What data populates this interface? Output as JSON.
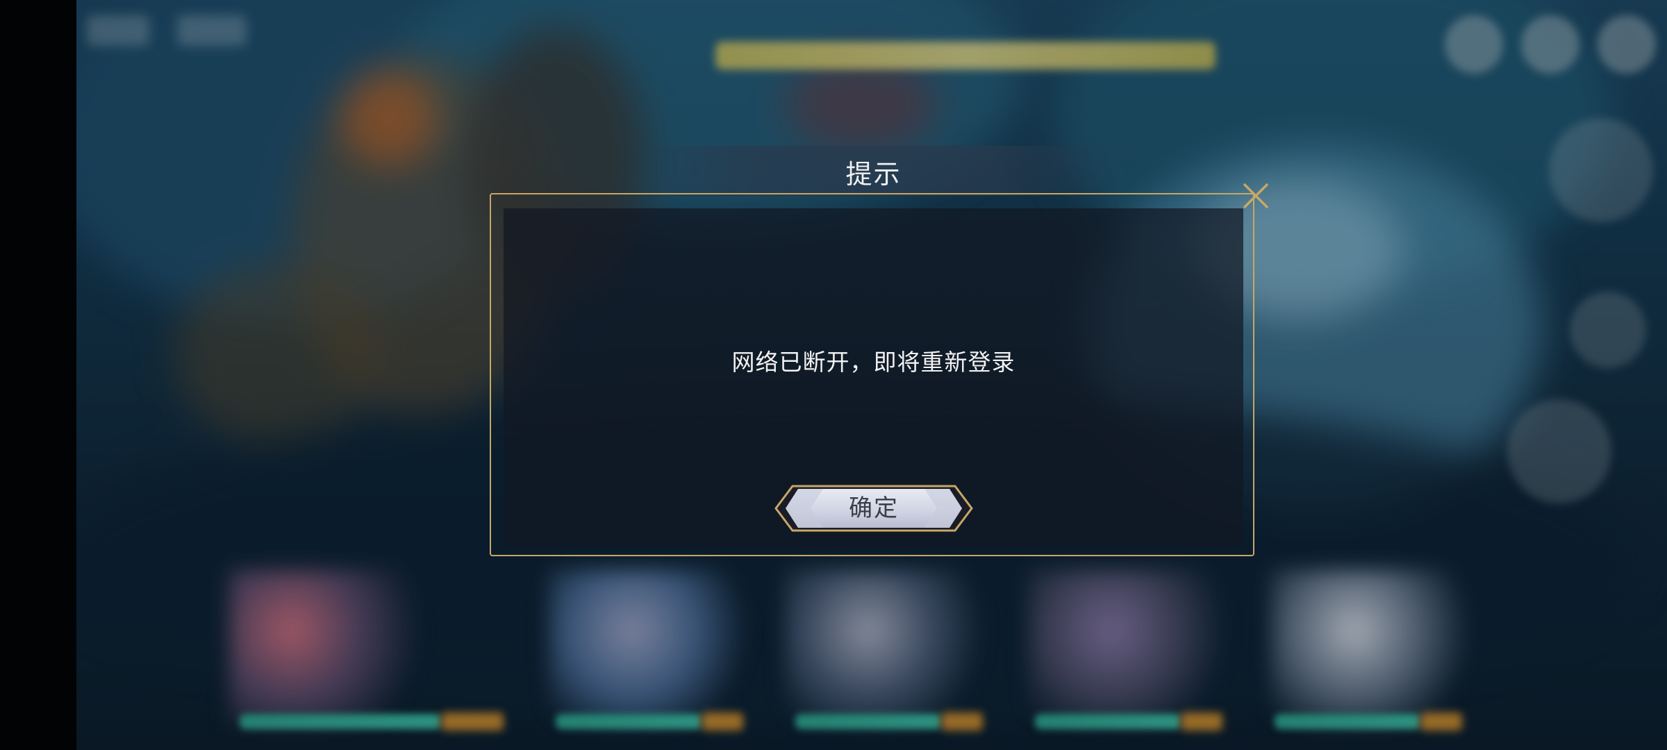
{
  "dialog": {
    "title": "提示",
    "message": "网络已断开，即将重新登录",
    "confirm_label": "确定",
    "close_icon": "close-icon"
  },
  "colors": {
    "frame_gold": "#c8a766",
    "panel_bg": "#121822",
    "button_face": "#d8dbe8"
  }
}
